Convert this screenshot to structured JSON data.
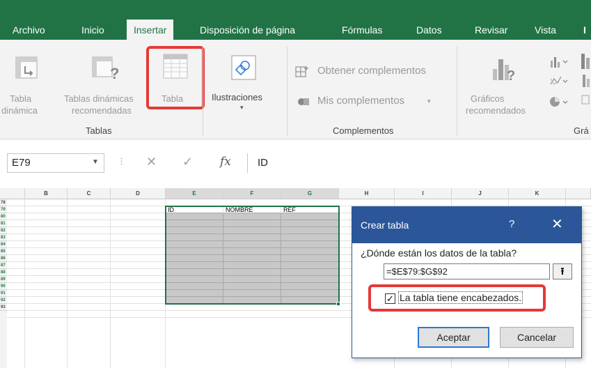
{
  "tabs": [
    "Archivo",
    "Inicio",
    "Insertar",
    "Disposición de página",
    "Fórmulas",
    "Datos",
    "Revisar",
    "Vista"
  ],
  "active_tab": "Insertar",
  "ribbon": {
    "tablas_group": {
      "name": "Tablas",
      "tabla_dinamica": [
        "Tabla",
        "dinámica"
      ],
      "tablas_dinamicas_recomendadas": [
        "Tablas dinámicas",
        "recomendadas"
      ],
      "tabla": "Tabla"
    },
    "ilustraciones": "Ilustraciones",
    "complementos_group": {
      "name": "Complementos",
      "obtener": "Obtener complementos",
      "mis": "Mis complementos"
    },
    "graficos": [
      "Gráficos",
      "recomendados"
    ],
    "graficos_group_partial": "Grá"
  },
  "formula_bar": {
    "name_box": "E79",
    "fx": "fx",
    "content": "ID"
  },
  "grid": {
    "columns": [
      "B",
      "C",
      "D",
      "E",
      "F",
      "G",
      "H",
      "I",
      "J",
      "K"
    ],
    "rows": [
      "78",
      "79",
      "80",
      "81",
      "82",
      "83",
      "84",
      "85",
      "86",
      "87",
      "88",
      "89",
      "90",
      "91",
      "92",
      "93"
    ],
    "headers": [
      "ID",
      "NOMBRE",
      "REF"
    ]
  },
  "dialog": {
    "title": "Crear tabla",
    "help": "?",
    "close": "✕",
    "question": "¿Dónde están los datos de la tabla?",
    "range": "=$E$79:$G$92",
    "checkbox_label": "La tabla tiene encabezados.",
    "checkbox_checked": true,
    "accept": "Aceptar",
    "cancel": "Cancelar"
  },
  "accent_color": "#217346",
  "highlight_color": "#e53935"
}
